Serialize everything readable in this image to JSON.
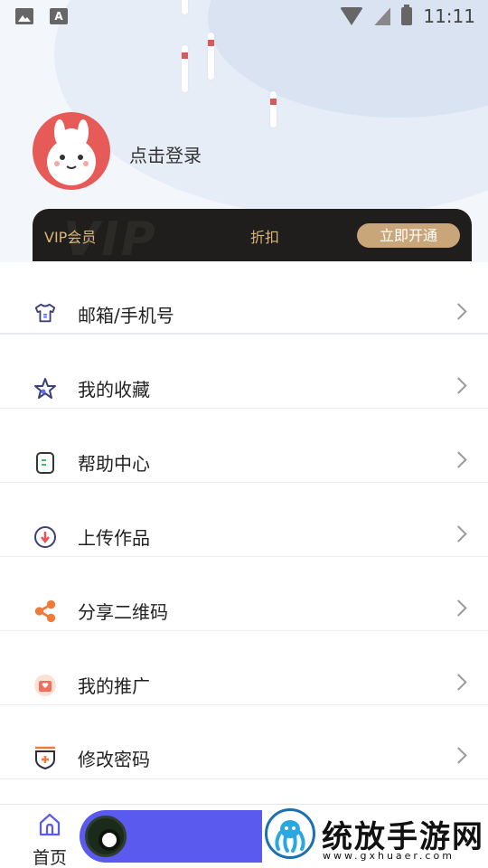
{
  "status_bar": {
    "time": "11:11",
    "left_icons": [
      "image-icon",
      "a-icon"
    ],
    "right_icons": [
      "wifi-icon",
      "no-signal-icon",
      "battery-charging-icon"
    ],
    "a_glyph": "A"
  },
  "profile": {
    "login_text": "点击登录",
    "avatar_icon": "alpaca-avatar-icon"
  },
  "vip": {
    "label": "VIP会员",
    "discount": "折扣",
    "button": "立即开通",
    "watermark": "VIP",
    "colors": {
      "bg": "#1f1e1c",
      "gold": "#d9b77a",
      "button": "#c9a57a"
    }
  },
  "menu": {
    "items": [
      {
        "label": "邮箱/手机号",
        "icon": "tshirt-icon"
      },
      {
        "label": "我的收藏",
        "icon": "star-icon"
      },
      {
        "label": "帮助中心",
        "icon": "document-icon"
      },
      {
        "label": "上传作品",
        "icon": "upload-circle-icon"
      },
      {
        "label": "分享二维码",
        "icon": "share-icon"
      },
      {
        "label": "我的推广",
        "icon": "promotion-bag-icon"
      },
      {
        "label": "修改密码",
        "icon": "password-shield-icon"
      }
    ]
  },
  "bottom_bar": {
    "home_label": "首页",
    "logo_text": "统放手游网",
    "logo_url": "www.gxhuaer.com",
    "accent": "#5a5aee"
  }
}
